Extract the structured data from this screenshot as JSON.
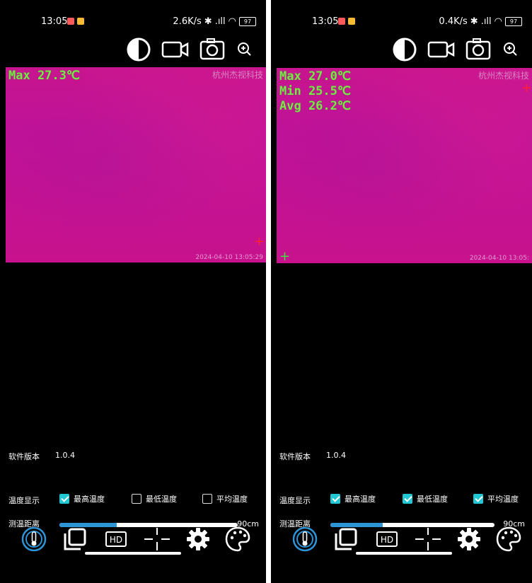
{
  "screens": [
    {
      "status": {
        "time": "13:05",
        "network_speed": "2.6K/s",
        "battery": "97"
      },
      "overlay": {
        "lines": [
          "Max 27.3℃"
        ],
        "brand": "杭州杰视科技",
        "timestamp": "2024-04-10 13:05:29"
      },
      "info": {
        "version_label": "软件版本",
        "version_value": "1.0.4",
        "temp_display_label": "温度显示",
        "options": [
          {
            "label": "最高温度",
            "checked": true
          },
          {
            "label": "最低温度",
            "checked": false
          },
          {
            "label": "平均温度",
            "checked": false
          }
        ],
        "distance_label": "测温距离",
        "distance_fill": 0.32,
        "distance_value": "90cm"
      }
    },
    {
      "status": {
        "time": "13:05",
        "network_speed": "0.4K/s",
        "battery": "97"
      },
      "overlay": {
        "lines": [
          "Max 27.0℃",
          "Min 25.5℃",
          "Avg 26.2℃"
        ],
        "brand": "杭州杰视科技",
        "timestamp": "2024-04-10 13:05:"
      },
      "info": {
        "version_label": "软件版本",
        "version_value": "1.0.4",
        "temp_display_label": "温度显示",
        "options": [
          {
            "label": "最高温度",
            "checked": true
          },
          {
            "label": "最低温度",
            "checked": true
          },
          {
            "label": "平均温度",
            "checked": true
          }
        ],
        "distance_label": "测温距离",
        "distance_fill": 0.32,
        "distance_value": "90cm"
      }
    }
  ],
  "colors": {
    "accent": "#21c7d3",
    "slider": "#2d94d6",
    "thermal": "#c8158f",
    "readout": "#7de44e"
  },
  "icons": {
    "toolbar": [
      "contrast-icon",
      "video-camera-icon",
      "camera-icon",
      "zoom-in-icon"
    ],
    "nav": [
      "thermometer-icon",
      "copy-icon",
      "hd-icon",
      "crosshair-icon",
      "gear-icon",
      "palette-icon"
    ]
  }
}
